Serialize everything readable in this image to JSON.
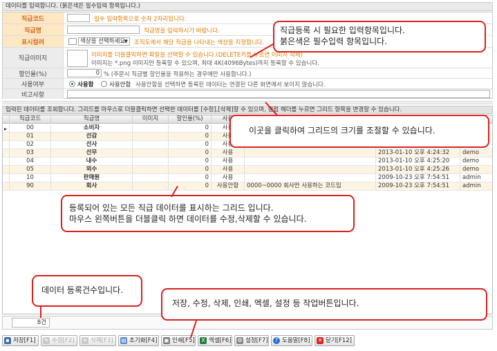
{
  "top_bar": {
    "text": "데이터를 입력합니다. (붉은색은 필수입력 항목입니다.)"
  },
  "form": {
    "code": {
      "label": "직급코드",
      "hint": "필수 입력항목으로 숫자 2자리입니다."
    },
    "name": {
      "label": "직급명",
      "hint": "직급명을 입력하시기 바랍니다."
    },
    "color": {
      "label": "표시컬러",
      "placeholder": "색상을 선택하세요",
      "hint": "조직도에서 해당 직급을 나타내는 색상을 지정합니다."
    },
    "image": {
      "label": "직급이미지",
      "hint1": "이미지를 더블클릭하면 파일을 선택할 수 있습니다.(DELETE키를 누르면 이미지 삭제)",
      "hint2": "이미지는 *.png 이미지만 등록할 수 있으며, 최대 4K(4096Bytes)까지 등록할 수 있습니다."
    },
    "discount": {
      "label": "할인율(%)",
      "value": "0",
      "hint": "% (주문시 직급별 할인율을 적용하는 경우에만 사용합니다.)"
    },
    "use": {
      "label": "사용여부",
      "opt_on": "사용함",
      "opt_off": "사용안함",
      "hint": "사용안함을 선택하면 등록된 데이터는 연결된 다른 화면에서 보이지 않습니다."
    },
    "note": {
      "label": "비고사항"
    }
  },
  "grid_caption": "입력된 데이터를 조회합니다. 그리드를 마우스로 더블클릭하면 선택한 데이터를 [수정],[삭제]할 수 있으며, 컬럼 헤더를 누르면 그리드 항목을 변경할 수 있습니다.",
  "grid": {
    "columns": [
      "직급코드",
      "직급명",
      "이미지",
      "할인율(%)",
      "사용",
      "",
      "",
      ""
    ],
    "rows": [
      {
        "code": "00",
        "name": "소비자",
        "disc": "0",
        "use": "사용",
        "note": "",
        "date": "",
        "user": ""
      },
      {
        "code": "01",
        "name": "선감",
        "disc": "0",
        "use": "사용",
        "note": "",
        "date": "",
        "user": ""
      },
      {
        "code": "02",
        "name": "선사",
        "disc": "0",
        "use": "사용",
        "note": "",
        "date": "",
        "user": ""
      },
      {
        "code": "03",
        "name": "선무",
        "disc": "0",
        "use": "사용",
        "note": "",
        "date": "2013-01-10 오후 4:24:32",
        "user": "demo"
      },
      {
        "code": "04",
        "name": "내수",
        "disc": "0",
        "use": "사용",
        "note": "",
        "date": "2013-01-10 오후 4:25:20",
        "user": "demo"
      },
      {
        "code": "05",
        "name": "외수",
        "disc": "0",
        "use": "사용",
        "note": "",
        "date": "2013-01-10 오후 4:25:26",
        "user": "demo"
      },
      {
        "code": "10",
        "name": "판매원",
        "disc": "0",
        "use": "사용",
        "note": "",
        "date": "2009-10-23 오후 7:54:51",
        "user": "admin"
      },
      {
        "code": "90",
        "name": "회사",
        "disc": "0",
        "use": "사용안함",
        "note": "0000~0000 회사만 사용하는 코드임",
        "date": "2009-10-23 오후 7:54:51",
        "user": "admin"
      }
    ]
  },
  "count": "8건",
  "toolbar": {
    "save": "저장[F1]",
    "edit": "수정[F2]",
    "delete": "삭제[F3]",
    "reset": "초기화[F4]",
    "print": "인쇄[F5]",
    "excel": "엑셀[F6]",
    "settings": "설정[F7]",
    "help": "도움말[F8]",
    "close": "닫기[F12]"
  },
  "callouts": {
    "form": [
      "직급등록 시 필요한 입력항목입니다.",
      "붉은색은 필수입력 항목입니다."
    ],
    "resize": "이곳을 클릭하여 그리드의 크기를 조절할 수 있습니다.",
    "grid": [
      "등록되어 있는 모든 직급 데이터를 표시하는 그리드 입니다.",
      "마우스 왼쪽버튼을 더블클릭 하면 데이터를 수정,삭제할 수 있습니다."
    ],
    "count": "데이터 등록건수입니다.",
    "toolbar": "저장, 수정, 삭제, 인쇄, 엑셀, 설정 등 작업버튼입니다."
  },
  "colors": {
    "required_bg": "#fde8c3",
    "required_text": "#d2691e",
    "hint_orange": "#e07b00",
    "callout_border": "#d9201d",
    "row_alt": "#fdf4e3"
  }
}
